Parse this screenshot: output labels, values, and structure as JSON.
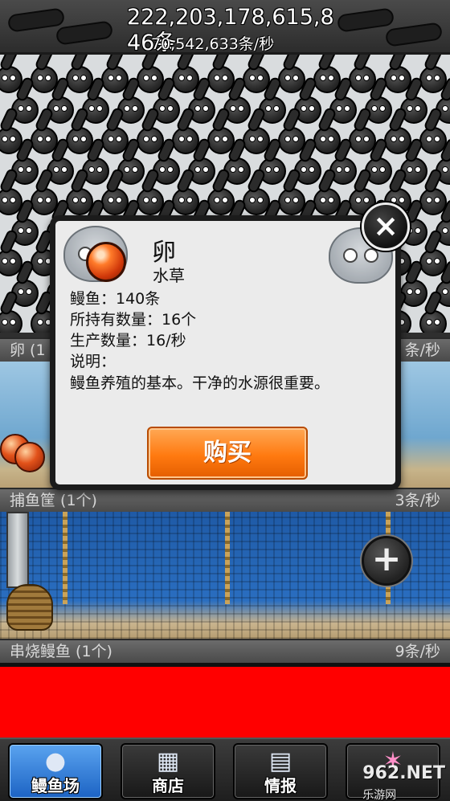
{
  "counter": {
    "total": "222,203,178,615,846条",
    "rate": "70,542,633条/秒"
  },
  "rows": [
    {
      "name": "卵 (1",
      "rate": "条/秒"
    },
    {
      "name": "捕鱼筐 (1个)",
      "rate": "3条/秒"
    },
    {
      "name": "串烧鳗鱼 (1个)",
      "rate": "9条/秒"
    }
  ],
  "dialog": {
    "title": "卵",
    "subtitle": "水草",
    "price": "鳗鱼：140条",
    "owned": "所持有数量：16个",
    "production": "生产数量：16/秒",
    "desc_label": "说明：",
    "description": "鳗鱼养殖的基本。干净的水源很重要。",
    "buy_label": "购买",
    "close_icon": "×"
  },
  "row_buttons": {
    "add_icon": "+"
  },
  "nav": {
    "items": [
      {
        "label": "鳗鱼场",
        "icon": "eel-icon",
        "active": true
      },
      {
        "label": "商店",
        "icon": "shop-icon",
        "active": false
      },
      {
        "label": "情报",
        "icon": "news-icon",
        "active": false
      },
      {
        "label": "",
        "icon": "star-icon",
        "active": false
      }
    ]
  },
  "watermark": {
    "text": "962.NET",
    "sub": "乐游网"
  },
  "colors": {
    "banner": "#ff0000",
    "buy_button": "#ff7a10",
    "nav_active": "#1c63c4"
  }
}
